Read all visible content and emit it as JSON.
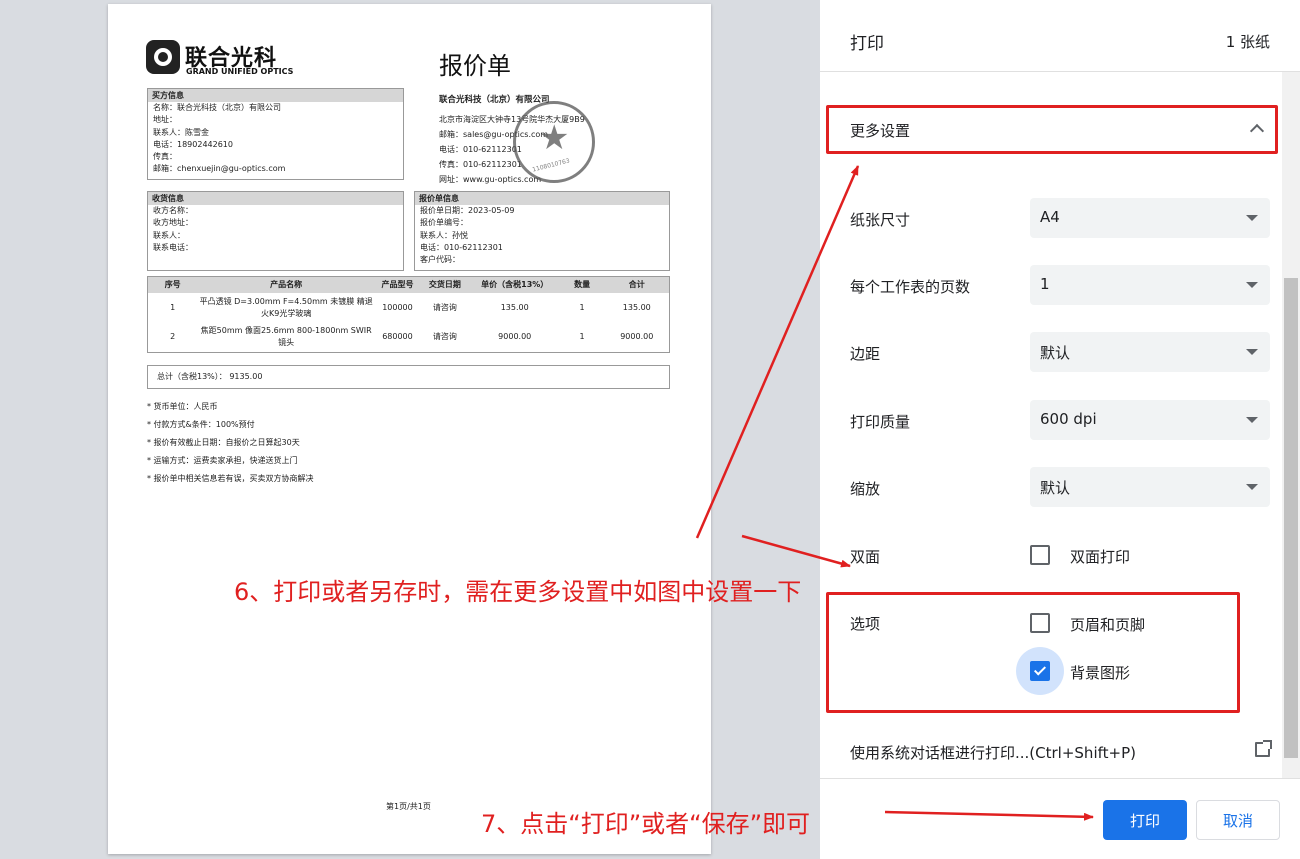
{
  "document": {
    "logo": {
      "cn": "联合光科",
      "en": "GRAND UNIFIED OPTICS"
    },
    "title": "报价单",
    "company": {
      "name": "联合光科技（北京）有限公司",
      "address": "北京市海淀区大钟寺13号院华杰大厦9B9",
      "email": "邮箱：sales@gu-optics.com",
      "phone": "电话：010-62112301",
      "fax": "传真：010-62112301",
      "website": "网址：www.gu-optics.com"
    },
    "stamp": {
      "text": "联合光科技(北京)有限公司 合同专用章",
      "code": "1108010763"
    },
    "buyer": {
      "heading": "买方信息",
      "lines": [
        "名称：联合光科技（北京）有限公司",
        "地址：",
        "联系人：陈雪金",
        "电话：18902442610",
        "传真：",
        "邮箱：chenxuejin@gu-optics.com"
      ]
    },
    "shipping": {
      "heading": "收货信息",
      "lines": [
        "收方名称：",
        "收方地址：",
        "联系人：",
        "联系电话："
      ]
    },
    "quote_info": {
      "heading": "报价单信息",
      "lines": [
        "报价单日期：2023-05-09",
        "报价单编号：",
        "联系人：孙悦",
        "电话：010-62112301",
        "客户代码："
      ]
    },
    "table": {
      "headers": [
        "序号",
        "产品名称",
        "产品型号",
        "交货日期",
        "单价（含税13%）",
        "数量",
        "合计"
      ],
      "rows": [
        [
          "1",
          "平凸透镜 D=3.00mm F=4.50mm 未镀膜 精退火K9光学玻璃",
          "100000",
          "请咨询",
          "135.00",
          "1",
          "135.00"
        ],
        [
          "2",
          "焦距50mm 像面25.6mm 800-1800nm SWIR镜头",
          "680000",
          "请咨询",
          "9000.00",
          "1",
          "9000.00"
        ]
      ]
    },
    "total": "总计（含税13%）：  9135.00",
    "notes": [
      "* 货币单位：人民币",
      "* 付款方式&条件：100%预付",
      "* 报价有效截止日期：自报价之日算起30天",
      "* 运输方式：运费卖家承担，快递送货上门",
      "* 报价单中相关信息若有误，买卖双方协商解决"
    ],
    "page_number": "第1页/共1页"
  },
  "panel": {
    "title": "打印",
    "sheet_count": "1 张纸",
    "more_settings": "更多设置",
    "settings": [
      {
        "label": "纸张尺寸",
        "value": "A4"
      },
      {
        "label": "每个工作表的页数",
        "value": "1"
      },
      {
        "label": "边距",
        "value": "默认"
      },
      {
        "label": "打印质量",
        "value": "600 dpi"
      },
      {
        "label": "缩放",
        "value": "默认"
      }
    ],
    "duplex": {
      "label": "双面",
      "option": "双面打印",
      "checked": false
    },
    "options": {
      "label": "选项",
      "headers_footers": {
        "label": "页眉和页脚",
        "checked": false
      },
      "background_graphics": {
        "label": "背景图形",
        "checked": true
      }
    },
    "system_dialog": "使用系统对话框进行打印...(Ctrl+Shift+P)",
    "print_button": "打印",
    "cancel_button": "取消"
  },
  "annotations": {
    "step6": "6、打印或者另存时，需在更多设置中如图中设置一下",
    "step7": "7、点击“打印”或者“保存”即可",
    "color": "#e02020"
  },
  "icons": [
    "chevron-up-icon",
    "dropdown-caret-icon",
    "checkbox-icon",
    "checkmark-icon",
    "external-link-icon",
    "stamp-star-icon"
  ]
}
